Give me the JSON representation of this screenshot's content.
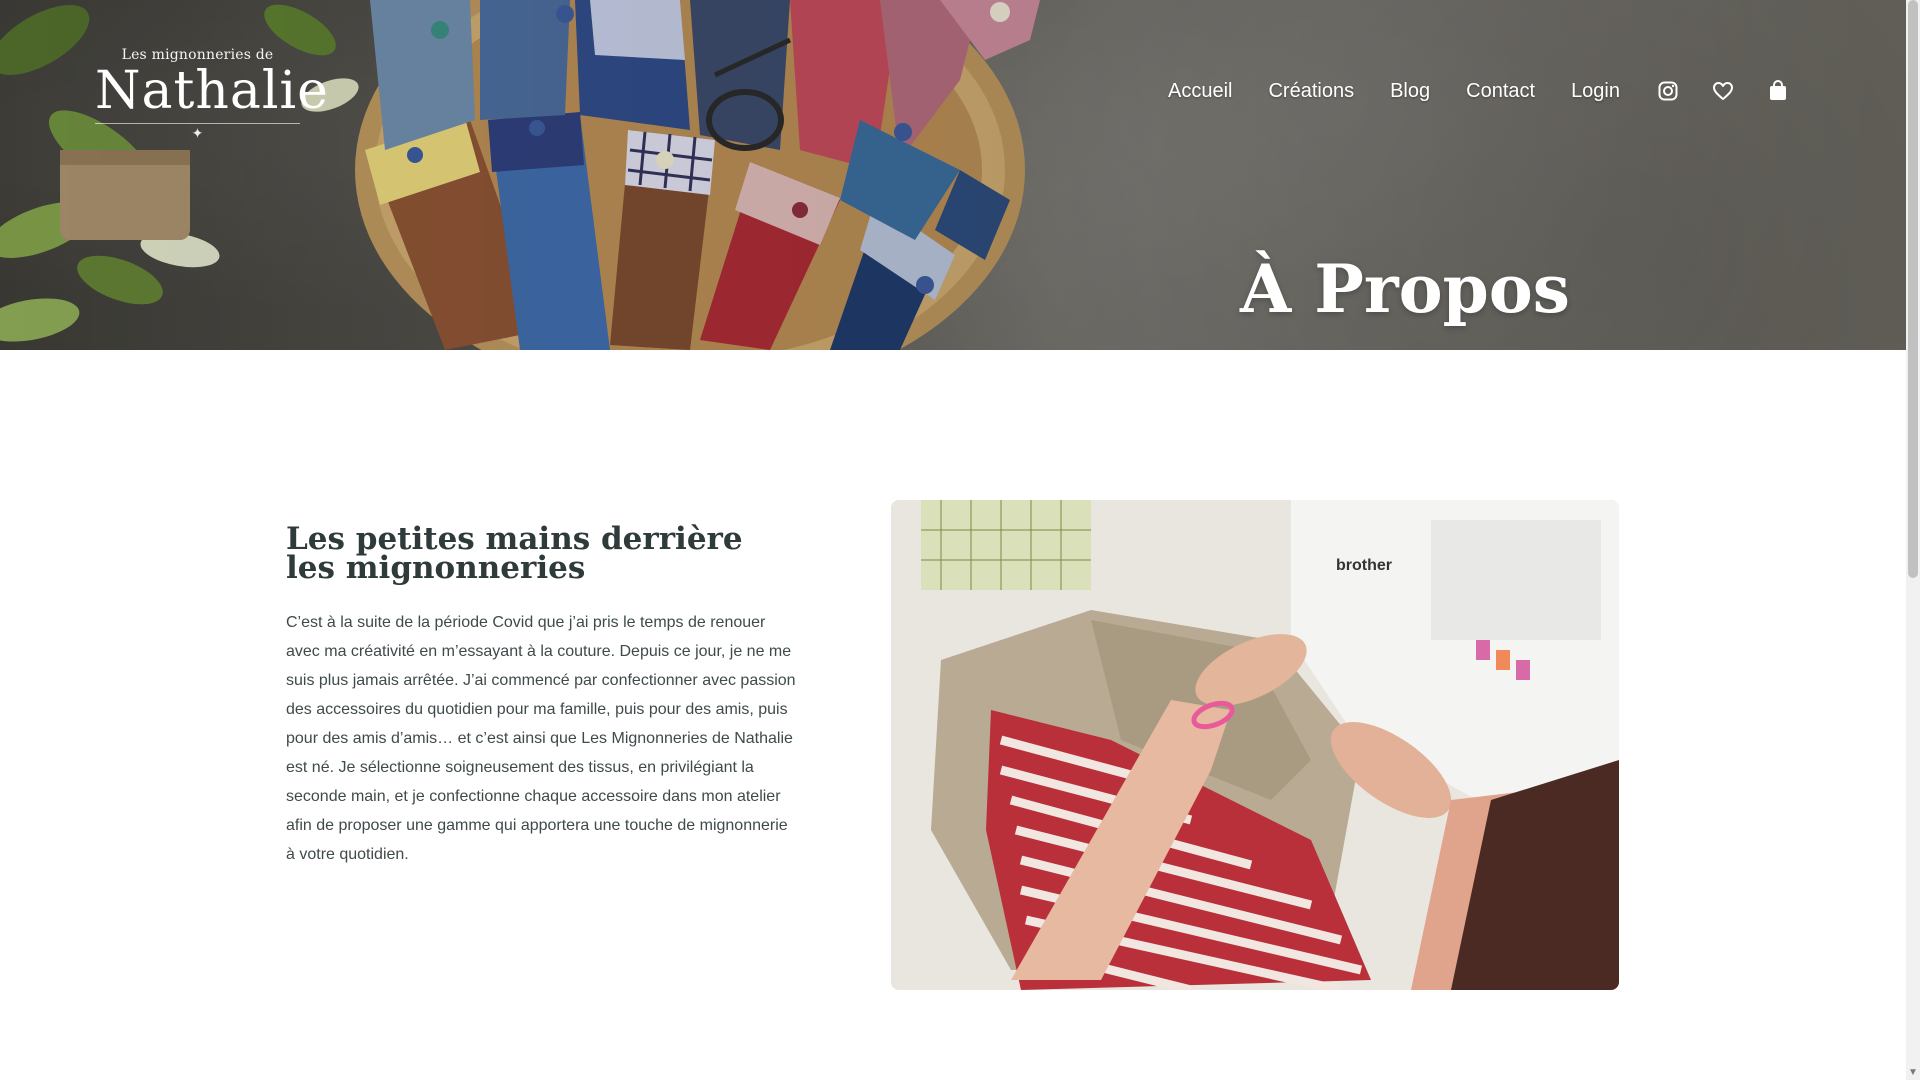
{
  "brand": {
    "small_line": "Les mignonneries de",
    "name": "Nathalie",
    "sparkle": "✦"
  },
  "nav": {
    "items": [
      {
        "label": "Accueil"
      },
      {
        "label": "Créations"
      },
      {
        "label": "Blog"
      },
      {
        "label": "Contact"
      },
      {
        "label": "Login"
      }
    ],
    "icons": [
      "instagram-icon",
      "heart-icon",
      "shopping-bag-icon"
    ]
  },
  "hero": {
    "title": "À Propos"
  },
  "about": {
    "heading_line1": "Les petites mains derrière",
    "heading_line2": "les mignonneries",
    "body": "C’est à la suite de la période Covid que j’ai pris le temps de renouer avec ma créativité en m’essayant à la couture. Depuis ce jour, je ne me suis plus jamais arrêtée. J’ai commencé par confectionner avec passion des accessoires du quotidien pour ma famille, puis pour des amis, puis pour des amis d’amis… et c’est ainsi que Les Mignonneries de Nathalie est né. Je sélectionne soigneusement des tissus, en privilégiant la seconde main, et je confectionne chaque accessoire dans mon atelier afin de proposer une gamme qui apportera une touche de mignonnerie à votre quotidien.",
    "image_label": "brother"
  },
  "colors": {
    "heading": "#2f3a3b",
    "body_text": "#3f4a4b",
    "nav_text": "#ffffff"
  }
}
